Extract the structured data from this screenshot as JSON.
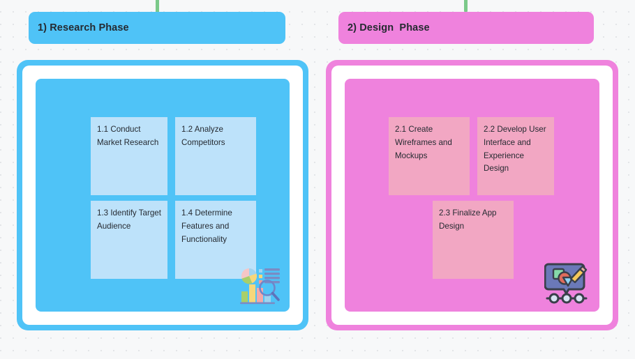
{
  "board": {
    "background_color": "#f7f8f9",
    "dot_color": "#e3e5e8",
    "connector_color": "#7bc98a"
  },
  "phases": [
    {
      "id": "research",
      "header_label": "1) Research Phase",
      "accent_color": "#4fc3f7",
      "note_color": "#bde2fa",
      "icon_name": "market-research-icon",
      "notes": [
        {
          "label": "1.1 Conduct Market Research"
        },
        {
          "label": "1.2 Analyze Competitors"
        },
        {
          "label": "1.3 Identify Target Audience"
        },
        {
          "label": "1.4 Determine Features and Functionality"
        }
      ]
    },
    {
      "id": "design",
      "header_label": "2) Design  Phase",
      "accent_color": "#ef82dd",
      "note_color": "#f2a7c3",
      "icon_name": "design-tools-icon",
      "notes": [
        {
          "label": "2.1 Create Wireframes and Mockups"
        },
        {
          "label": "2.2 Develop User Interface and Experience Design"
        },
        {
          "label": "2.3 Finalize App Design"
        }
      ]
    }
  ]
}
